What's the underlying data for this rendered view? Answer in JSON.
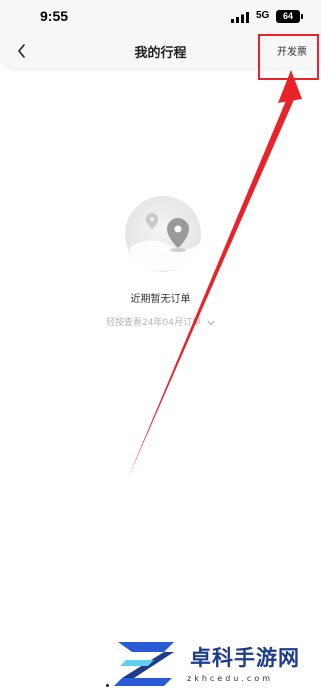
{
  "status_bar": {
    "time": "9:55",
    "network": "5G",
    "battery": "64"
  },
  "header": {
    "title": "我的行程",
    "invoice_label": "开发票"
  },
  "empty_state": {
    "title": "近期暂无订单",
    "history_link": "轻按查看24年04月订单"
  },
  "watermark": {
    "text": "卓科手游网",
    "url": "zkhcedu.com"
  },
  "colors": {
    "annotation": "#e8232a",
    "watermark_blue": "#1e3c8c",
    "muted_text": "#b4b4b4"
  }
}
